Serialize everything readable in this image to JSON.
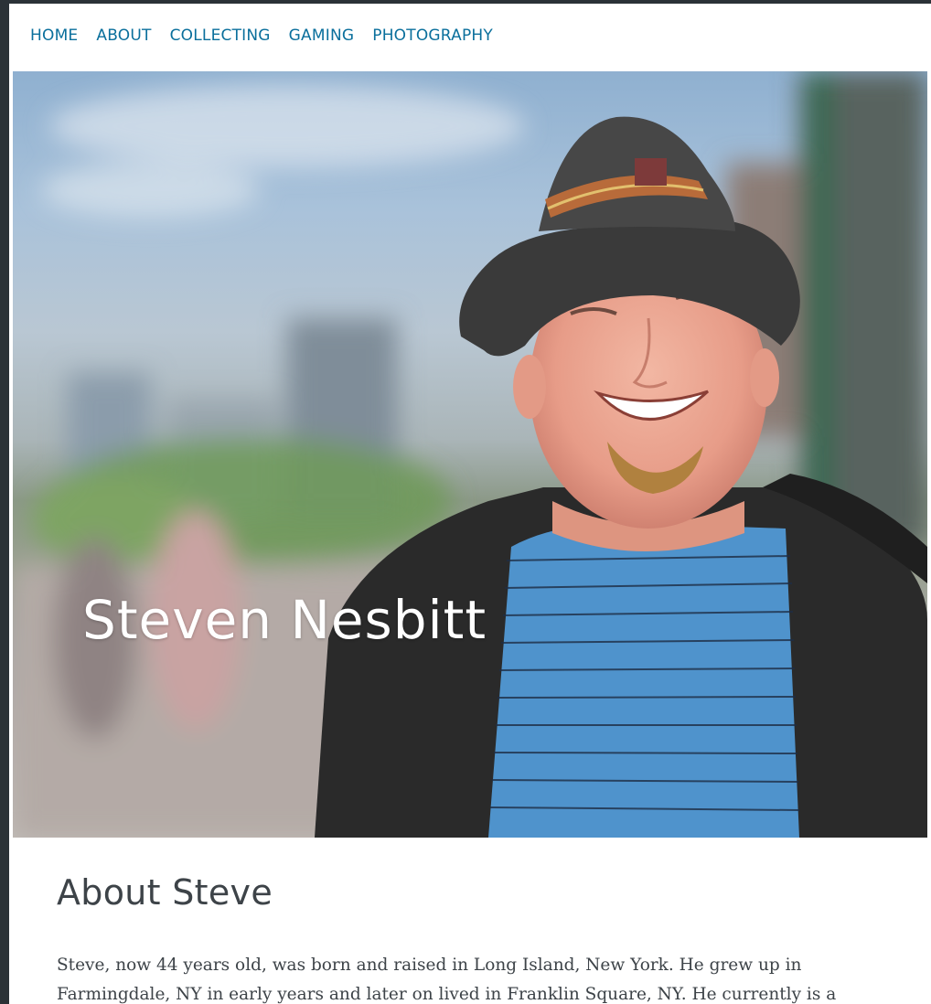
{
  "nav": {
    "items": [
      {
        "label": "HOME"
      },
      {
        "label": "ABOUT"
      },
      {
        "label": "COLLECTING"
      },
      {
        "label": "GAMING"
      },
      {
        "label": "PHOTOGRAPHY"
      }
    ]
  },
  "hero": {
    "title": "Steven Nesbitt"
  },
  "about": {
    "heading": "About Steve",
    "paragraph": "Steve, now 44 years old, was born and raised in Long Island, New York. He grew up in Farmingdale, NY in early years and later on lived in Franklin Square, NY. He currently is a"
  },
  "colors": {
    "nav_link": "#0a6f9c",
    "heading": "#3d4348",
    "page_border": "#2b3237"
  }
}
